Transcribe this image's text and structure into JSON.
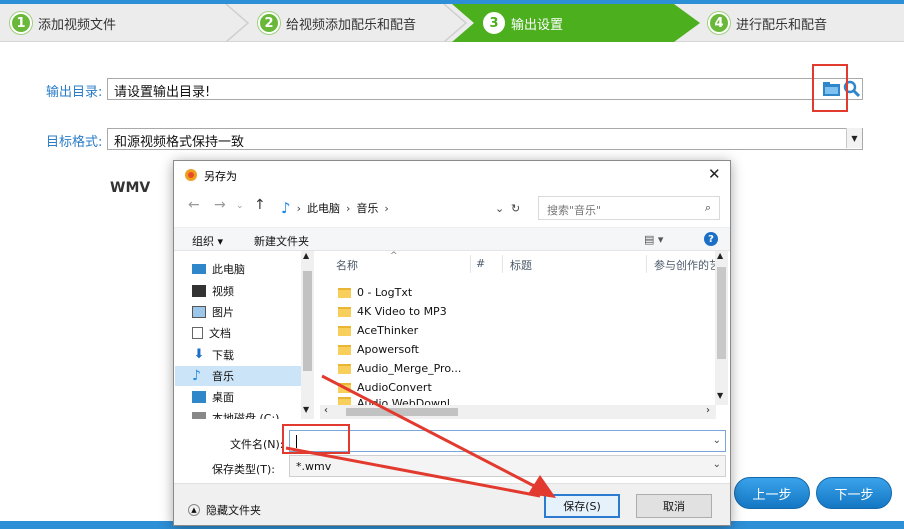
{
  "steps": [
    {
      "num": "1",
      "label": "添加视频文件"
    },
    {
      "num": "2",
      "label": "给视频添加配乐和配音"
    },
    {
      "num": "3",
      "label": "输出设置"
    },
    {
      "num": "4",
      "label": "进行配乐和配音"
    }
  ],
  "form": {
    "output_dir_label": "输出目录:",
    "output_dir_value": "请设置输出目录!",
    "format_label": "目标格式:",
    "format_value": "和源视频格式保持一致",
    "format_name": "WMV"
  },
  "nav": {
    "prev": "上一步",
    "next": "下一步"
  },
  "dialog": {
    "title": "另存为",
    "breadcrumb": [
      "此电脑",
      "音乐"
    ],
    "search_placeholder": "搜索\"音乐\"",
    "toolbar": {
      "organize": "组织 ▾",
      "new_folder": "新建文件夹"
    },
    "tree": [
      "此电脑",
      "视频",
      "图片",
      "文档",
      "下载",
      "音乐",
      "桌面",
      "本地磁盘 (C:)"
    ],
    "columns": [
      "名称",
      "#",
      "标题",
      "参与创作的艺"
    ],
    "files": [
      "0 - LogTxt",
      "4K Video to MP3",
      "AceThinker",
      "Apowersoft",
      "Audio_Merge_Pro...",
      "AudioConvert",
      "Audio WebDownl..."
    ],
    "filename_label": "文件名(N):",
    "filename_value": "",
    "filetype_label": "保存类型(T):",
    "filetype_value": "*.wmv",
    "hide_folders": "隐藏文件夹",
    "save": "保存(S)",
    "cancel": "取消"
  },
  "colors": {
    "accent_blue": "#2d8fd6",
    "step_green": "#69b83a",
    "active_green": "#4caf1e",
    "annotation_red": "#e23a2e"
  }
}
